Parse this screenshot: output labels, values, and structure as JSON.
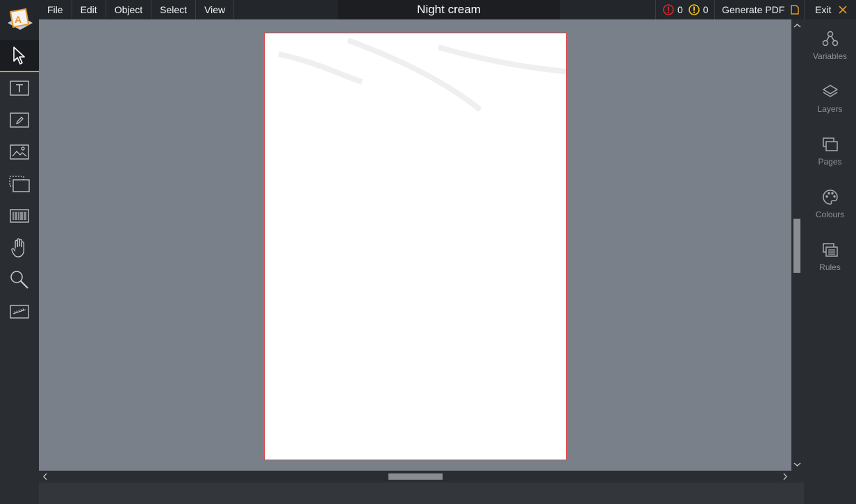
{
  "menu": [
    "File",
    "Edit",
    "Object",
    "Select",
    "View"
  ],
  "document_title": "Night cream",
  "status": {
    "errors": "0",
    "warnings": "0",
    "error_color": "#d9262c",
    "warning_color": "#f0c419"
  },
  "actions": {
    "generate_pdf": "Generate PDF",
    "exit": "Exit"
  },
  "tools": [
    {
      "icon": "pointer-icon",
      "active": true
    },
    {
      "icon": "text-tool-icon"
    },
    {
      "icon": "pencil-icon"
    },
    {
      "icon": "image-icon"
    },
    {
      "icon": "frame-icon"
    },
    {
      "icon": "barcode-icon"
    },
    {
      "icon": "hand-icon"
    },
    {
      "icon": "zoom-icon"
    },
    {
      "icon": "ruler-icon"
    }
  ],
  "panels": [
    {
      "label": "Variables",
      "icon": "variables-icon"
    },
    {
      "label": "Layers",
      "icon": "layers-icon"
    },
    {
      "label": "Pages",
      "icon": "pages-icon"
    },
    {
      "label": "Colours",
      "icon": "palette-icon"
    },
    {
      "label": "Rules",
      "icon": "rules-icon"
    }
  ],
  "colors": {
    "accent": "#e8972e",
    "page_border": "#d3353b",
    "canvas": "#7a8089"
  }
}
